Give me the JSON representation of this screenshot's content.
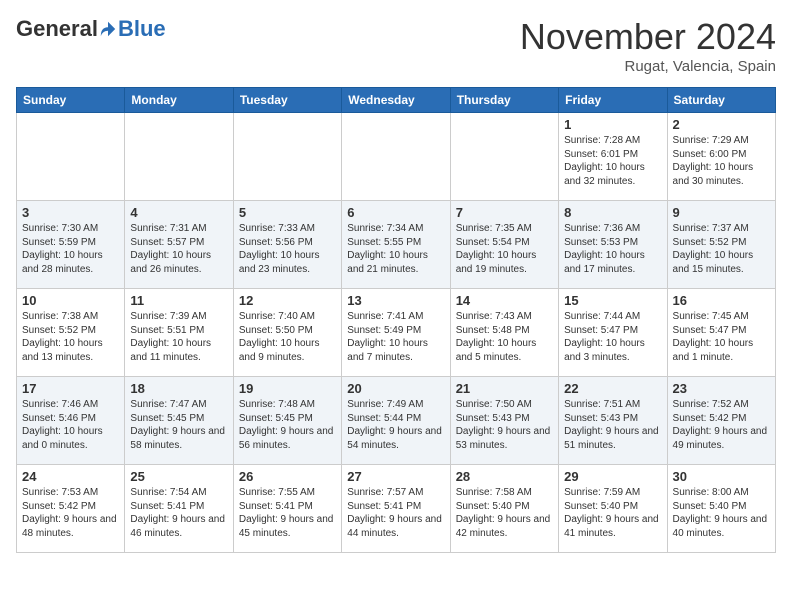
{
  "header": {
    "logo_general": "General",
    "logo_blue": "Blue",
    "month": "November 2024",
    "location": "Rugat, Valencia, Spain"
  },
  "days_of_week": [
    "Sunday",
    "Monday",
    "Tuesday",
    "Wednesday",
    "Thursday",
    "Friday",
    "Saturday"
  ],
  "weeks": [
    [
      {
        "day": "",
        "text": ""
      },
      {
        "day": "",
        "text": ""
      },
      {
        "day": "",
        "text": ""
      },
      {
        "day": "",
        "text": ""
      },
      {
        "day": "",
        "text": ""
      },
      {
        "day": "1",
        "text": "Sunrise: 7:28 AM\nSunset: 6:01 PM\nDaylight: 10 hours and 32 minutes."
      },
      {
        "day": "2",
        "text": "Sunrise: 7:29 AM\nSunset: 6:00 PM\nDaylight: 10 hours and 30 minutes."
      }
    ],
    [
      {
        "day": "3",
        "text": "Sunrise: 7:30 AM\nSunset: 5:59 PM\nDaylight: 10 hours and 28 minutes."
      },
      {
        "day": "4",
        "text": "Sunrise: 7:31 AM\nSunset: 5:57 PM\nDaylight: 10 hours and 26 minutes."
      },
      {
        "day": "5",
        "text": "Sunrise: 7:33 AM\nSunset: 5:56 PM\nDaylight: 10 hours and 23 minutes."
      },
      {
        "day": "6",
        "text": "Sunrise: 7:34 AM\nSunset: 5:55 PM\nDaylight: 10 hours and 21 minutes."
      },
      {
        "day": "7",
        "text": "Sunrise: 7:35 AM\nSunset: 5:54 PM\nDaylight: 10 hours and 19 minutes."
      },
      {
        "day": "8",
        "text": "Sunrise: 7:36 AM\nSunset: 5:53 PM\nDaylight: 10 hours and 17 minutes."
      },
      {
        "day": "9",
        "text": "Sunrise: 7:37 AM\nSunset: 5:52 PM\nDaylight: 10 hours and 15 minutes."
      }
    ],
    [
      {
        "day": "10",
        "text": "Sunrise: 7:38 AM\nSunset: 5:52 PM\nDaylight: 10 hours and 13 minutes."
      },
      {
        "day": "11",
        "text": "Sunrise: 7:39 AM\nSunset: 5:51 PM\nDaylight: 10 hours and 11 minutes."
      },
      {
        "day": "12",
        "text": "Sunrise: 7:40 AM\nSunset: 5:50 PM\nDaylight: 10 hours and 9 minutes."
      },
      {
        "day": "13",
        "text": "Sunrise: 7:41 AM\nSunset: 5:49 PM\nDaylight: 10 hours and 7 minutes."
      },
      {
        "day": "14",
        "text": "Sunrise: 7:43 AM\nSunset: 5:48 PM\nDaylight: 10 hours and 5 minutes."
      },
      {
        "day": "15",
        "text": "Sunrise: 7:44 AM\nSunset: 5:47 PM\nDaylight: 10 hours and 3 minutes."
      },
      {
        "day": "16",
        "text": "Sunrise: 7:45 AM\nSunset: 5:47 PM\nDaylight: 10 hours and 1 minute."
      }
    ],
    [
      {
        "day": "17",
        "text": "Sunrise: 7:46 AM\nSunset: 5:46 PM\nDaylight: 10 hours and 0 minutes."
      },
      {
        "day": "18",
        "text": "Sunrise: 7:47 AM\nSunset: 5:45 PM\nDaylight: 9 hours and 58 minutes."
      },
      {
        "day": "19",
        "text": "Sunrise: 7:48 AM\nSunset: 5:45 PM\nDaylight: 9 hours and 56 minutes."
      },
      {
        "day": "20",
        "text": "Sunrise: 7:49 AM\nSunset: 5:44 PM\nDaylight: 9 hours and 54 minutes."
      },
      {
        "day": "21",
        "text": "Sunrise: 7:50 AM\nSunset: 5:43 PM\nDaylight: 9 hours and 53 minutes."
      },
      {
        "day": "22",
        "text": "Sunrise: 7:51 AM\nSunset: 5:43 PM\nDaylight: 9 hours and 51 minutes."
      },
      {
        "day": "23",
        "text": "Sunrise: 7:52 AM\nSunset: 5:42 PM\nDaylight: 9 hours and 49 minutes."
      }
    ],
    [
      {
        "day": "24",
        "text": "Sunrise: 7:53 AM\nSunset: 5:42 PM\nDaylight: 9 hours and 48 minutes."
      },
      {
        "day": "25",
        "text": "Sunrise: 7:54 AM\nSunset: 5:41 PM\nDaylight: 9 hours and 46 minutes."
      },
      {
        "day": "26",
        "text": "Sunrise: 7:55 AM\nSunset: 5:41 PM\nDaylight: 9 hours and 45 minutes."
      },
      {
        "day": "27",
        "text": "Sunrise: 7:57 AM\nSunset: 5:41 PM\nDaylight: 9 hours and 44 minutes."
      },
      {
        "day": "28",
        "text": "Sunrise: 7:58 AM\nSunset: 5:40 PM\nDaylight: 9 hours and 42 minutes."
      },
      {
        "day": "29",
        "text": "Sunrise: 7:59 AM\nSunset: 5:40 PM\nDaylight: 9 hours and 41 minutes."
      },
      {
        "day": "30",
        "text": "Sunrise: 8:00 AM\nSunset: 5:40 PM\nDaylight: 9 hours and 40 minutes."
      }
    ]
  ]
}
